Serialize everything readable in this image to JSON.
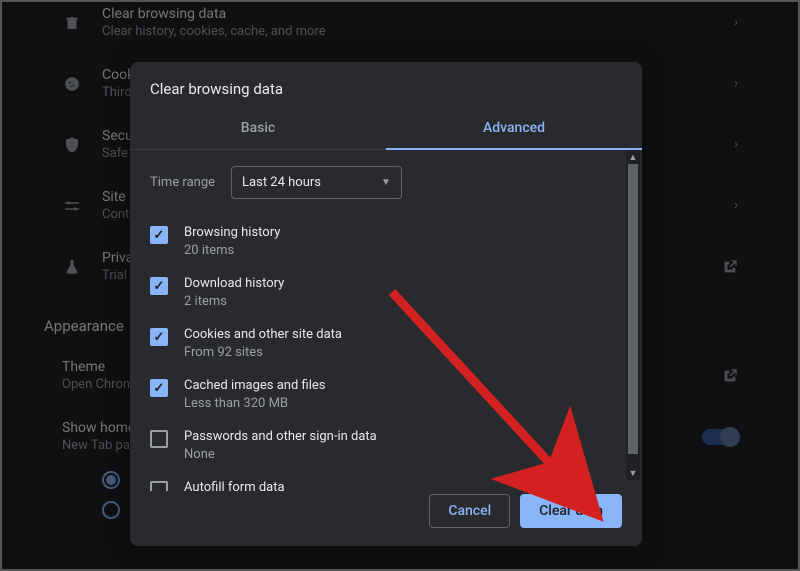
{
  "bg": {
    "rows": [
      {
        "title": "Clear browsing data",
        "sub": "Clear history, cookies, cache, and more",
        "icon": "trash"
      },
      {
        "title": "Cookies and other site data",
        "sub": "Third-party cookies are blocked in Incognito mode",
        "icon": "cookie"
      },
      {
        "title": "Security",
        "sub": "Safe Browsing (protection from dangerous sites) and other security settings",
        "icon": "shield"
      },
      {
        "title": "Site Settings",
        "sub": "Controls what information sites can use and show (location, camera, pop-ups, and more)",
        "icon": "sliders"
      },
      {
        "title": "Privacy Sandbox",
        "sub": "Trial features are on",
        "icon": "flask"
      }
    ],
    "appearanceHeading": "Appearance",
    "theme": {
      "title": "Theme",
      "sub": "Open Chrome Web Store"
    },
    "showHome": {
      "title": "Show home button",
      "sub": "New Tab page"
    },
    "url": "https://phoenixnap.com/kb/wp-admin/"
  },
  "dialog": {
    "title": "Clear browsing data",
    "tabs": {
      "basic": "Basic",
      "advanced": "Advanced"
    },
    "timeLabel": "Time range",
    "timeValue": "Last 24 hours",
    "items": [
      {
        "title": "Browsing history",
        "sub": "20 items",
        "checked": true
      },
      {
        "title": "Download history",
        "sub": "2 items",
        "checked": true
      },
      {
        "title": "Cookies and other site data",
        "sub": "From 92 sites",
        "checked": true
      },
      {
        "title": "Cached images and files",
        "sub": "Less than 320 MB",
        "checked": true
      },
      {
        "title": "Passwords and other sign-in data",
        "sub": "None",
        "checked": false
      },
      {
        "title": "Autofill form data",
        "sub": "",
        "checked": false
      }
    ],
    "cancel": "Cancel",
    "clear": "Clear data"
  }
}
